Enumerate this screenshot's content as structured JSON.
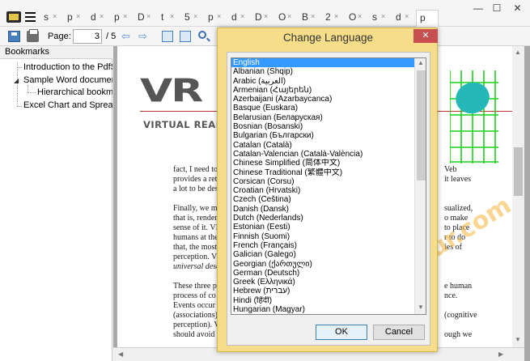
{
  "tabs": [
    {
      "label": "s",
      "close": "×"
    },
    {
      "label": "p",
      "close": "×"
    },
    {
      "label": "d",
      "close": "×"
    },
    {
      "label": "p",
      "close": "×"
    },
    {
      "label": "D",
      "close": "×"
    },
    {
      "label": "t",
      "close": "×"
    },
    {
      "label": "5",
      "close": "×"
    },
    {
      "label": "p",
      "close": "×"
    },
    {
      "label": "d",
      "close": "×"
    },
    {
      "label": "D",
      "close": "×"
    },
    {
      "label": "O",
      "close": "×"
    },
    {
      "label": "B",
      "close": "×"
    },
    {
      "label": "2",
      "close": "×"
    },
    {
      "label": "O",
      "close": "×"
    },
    {
      "label": "s",
      "close": "×"
    },
    {
      "label": "d",
      "close": "×"
    },
    {
      "label": "p",
      "close": "×"
    }
  ],
  "window": {
    "minimize": "—",
    "maximize": "☐",
    "close": "✕"
  },
  "toolbar": {
    "page_label": "Page:",
    "page_value": "3",
    "page_total": "/ 5"
  },
  "bookmarks": {
    "header": "Bookmarks",
    "items": [
      "Introduction to the PdfS",
      "Sample Word documen",
      "Hierarchical bookm",
      "Excel Chart and Spreads"
    ]
  },
  "document": {
    "logo": "VR",
    "subtitle": "VIRTUAL REALITY I",
    "paragraphs": [
      {
        "text": "fact, I need to"
      },
      {
        "text": "provides a ret"
      },
      {
        "text": "a lot to be des"
      },
      {
        "text": "Finally, we m"
      },
      {
        "text": "that is, render"
      },
      {
        "text": "sense of it. VI"
      },
      {
        "text": "humans at the"
      },
      {
        "text": "that, the most"
      },
      {
        "text": "perception. V"
      },
      {
        "text": "universal desc"
      },
      {
        "text": "These three p"
      },
      {
        "text": "process of co"
      },
      {
        "text": "Events occur"
      },
      {
        "text": "(associations)"
      },
      {
        "text": "perception). V"
      },
      {
        "text": "should avoid"
      }
    ],
    "right_fragments": [
      "Veb",
      "it leaves",
      "sualized,",
      "o make",
      "to place",
      "r to do",
      "ies of",
      "e human",
      "nce.",
      "(cognitive",
      "ough we"
    ]
  },
  "watermark": "FileOur.com",
  "dialog": {
    "title": "Change Language",
    "close": "✕",
    "selected_index": 0,
    "languages": [
      "English",
      "Albanian (Shqip)",
      "Arabic (العربية)",
      "Armenian (Հայերեն)",
      "Azerbaijani (Azarbaycanca)",
      "Basque (Euskara)",
      "Belarusian (Беларуская)",
      "Bosnian (Bosanski)",
      "Bulgarian (Български)",
      "Catalan (Català)",
      "Catalan-Valencian (Català-València)",
      "Chinese Simplified (简体中文)",
      "Chinese Traditional (繁體中文)",
      "Corsican (Corsu)",
      "Croatian (Hrvatski)",
      "Czech (Čeština)",
      "Danish (Dansk)",
      "Dutch (Nederlands)",
      "Estonian (Eesti)",
      "Finnish (Suomi)",
      "French (Français)",
      "Galician (Galego)",
      "Georgian (ქართული)",
      "German (Deutsch)",
      "Greek (Ελληνικά)",
      "Hebrew (עברית)",
      "Hindi (हिंदी)",
      "Hungarian (Magyar)"
    ],
    "ok_label": "OK",
    "cancel_label": "Cancel"
  }
}
